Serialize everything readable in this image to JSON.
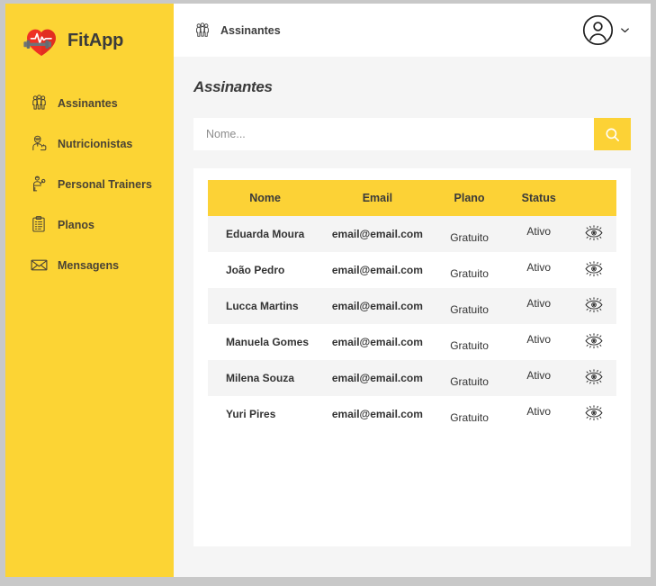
{
  "brand": {
    "name": "FitApp",
    "logo_icon": "heart-pulse-dumbbell-icon"
  },
  "sidebar": {
    "items": [
      {
        "label": "Assinantes",
        "icon": "group-people-icon"
      },
      {
        "label": "Nutricionistas",
        "icon": "nutritionist-icon"
      },
      {
        "label": "Personal Trainers",
        "icon": "personal-trainer-icon"
      },
      {
        "label": "Planos",
        "icon": "clipboard-checklist-icon"
      },
      {
        "label": "Mensagens",
        "icon": "envelope-icon"
      }
    ]
  },
  "topbar": {
    "title": "Assinantes",
    "title_icon": "group-people-icon",
    "avatar_icon": "user-circle-icon",
    "dropdown_icon": "chevron-down-icon"
  },
  "page": {
    "title": "Assinantes"
  },
  "search": {
    "placeholder": "Nome...",
    "value": "",
    "button_icon": "search-icon"
  },
  "table": {
    "columns": [
      "Nome",
      "Email",
      "Plano",
      "Status",
      ""
    ],
    "action_icon": "eye-icon",
    "rows": [
      {
        "nome": "Eduarda Moura",
        "email": "email@email.com",
        "plano": "Gratuito",
        "status": "Ativo"
      },
      {
        "nome": "João Pedro",
        "email": "email@email.com",
        "plano": "Gratuito",
        "status": "Ativo"
      },
      {
        "nome": "Lucca Martins",
        "email": "email@email.com",
        "plano": "Gratuito",
        "status": "Ativo"
      },
      {
        "nome": "Manuela Gomes",
        "email": "email@email.com",
        "plano": "Gratuito",
        "status": "Ativo"
      },
      {
        "nome": "Milena Souza",
        "email": "email@email.com",
        "plano": "Gratuito",
        "status": "Ativo"
      },
      {
        "nome": "Yuri Pires",
        "email": "email@email.com",
        "plano": "Gratuito",
        "status": "Ativo"
      }
    ]
  },
  "colors": {
    "sidebar_yellow": "#fcd434",
    "accent_yellow": "#fcd236",
    "heart_red": "#ee3124",
    "page_background": "#f5f5f5",
    "card_white": "#ffffff",
    "row_stripe": "#f4f4f4",
    "text_dark": "#3a3a3a",
    "window_frame": "#c8c8c8"
  }
}
